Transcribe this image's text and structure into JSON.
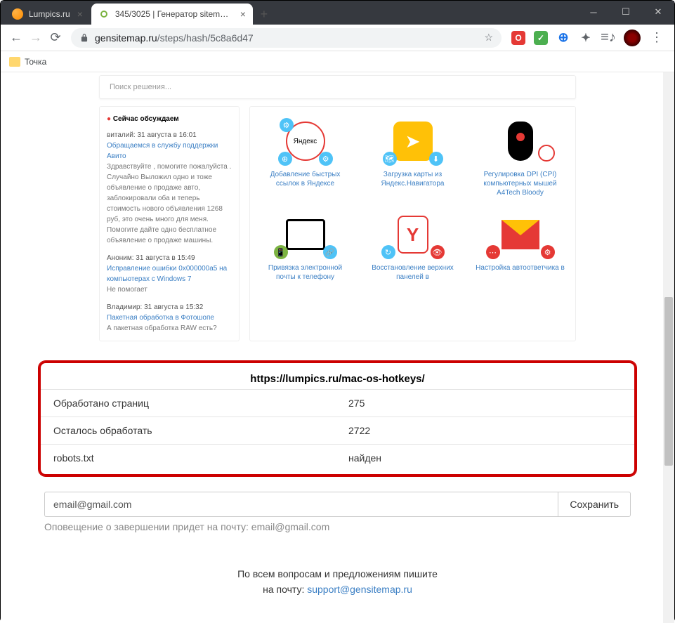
{
  "window": {
    "tabs": [
      {
        "title": "Lumpics.ru"
      },
      {
        "title": "345/3025 | Генератор sitemap о"
      }
    ]
  },
  "address": {
    "host": "gensitemap.ru",
    "path": "/steps/hash/5c8a6d47"
  },
  "bookmark": {
    "label": "Точка"
  },
  "search": {
    "placeholder": "Поиск решения..."
  },
  "discuss": {
    "heading": "Сейчас обсуждаем",
    "items": [
      {
        "meta": "виталий: 31 августа в 16:01",
        "link": "Обращаемся в службу поддержки Авито",
        "text": "Здравствуйте , помогите пожалуйста . Случайно Выложил одно и тоже объявление о продаже авто, заблокировали оба и теперь стоимость нового объявления 1268 руб, это очень много для меня. Помогите дайте одно бесплатное объявление о продаже машины."
      },
      {
        "meta": "Аноним: 31 августа в 15:49",
        "link": "Исправление ошибки 0x000000a5 на компьютерах с Windows 7",
        "text": "Не помогает"
      },
      {
        "meta": "Владимир: 31 августа в 15:32",
        "link": "Пакетная обработка в Фотошопе",
        "text": "А пакетная обработка RAW есть?"
      }
    ]
  },
  "grid": [
    {
      "caption": "Добавление быстрых ссылок в Яндексе"
    },
    {
      "caption": "Загрузка карты из Яндекс.Навигатора"
    },
    {
      "caption": "Регулировка DPI (CPI) компьютерных мышей A4Tech Bloody"
    },
    {
      "caption": "Привязка электронной почты к телефону"
    },
    {
      "caption": "Восстановление верхних панелей в"
    },
    {
      "caption": "Настройка автоответчика в"
    }
  ],
  "status": {
    "title": "https://lumpics.ru/mac-os-hotkeys/",
    "rows": [
      {
        "label": "Обработано страниц",
        "value": "275"
      },
      {
        "label": "Осталось обработать",
        "value": "2722"
      },
      {
        "label": "robots.txt",
        "value": "найден"
      }
    ]
  },
  "email": {
    "value": "email@gmail.com",
    "button": "Сохранить"
  },
  "notice": "Оповещение о завершении придет на почту: email@gmail.com",
  "footer": {
    "line1": "По всем вопросам и предложениям пишите",
    "line2_prefix": "на почту: ",
    "email": "support@gensitemap.ru"
  }
}
